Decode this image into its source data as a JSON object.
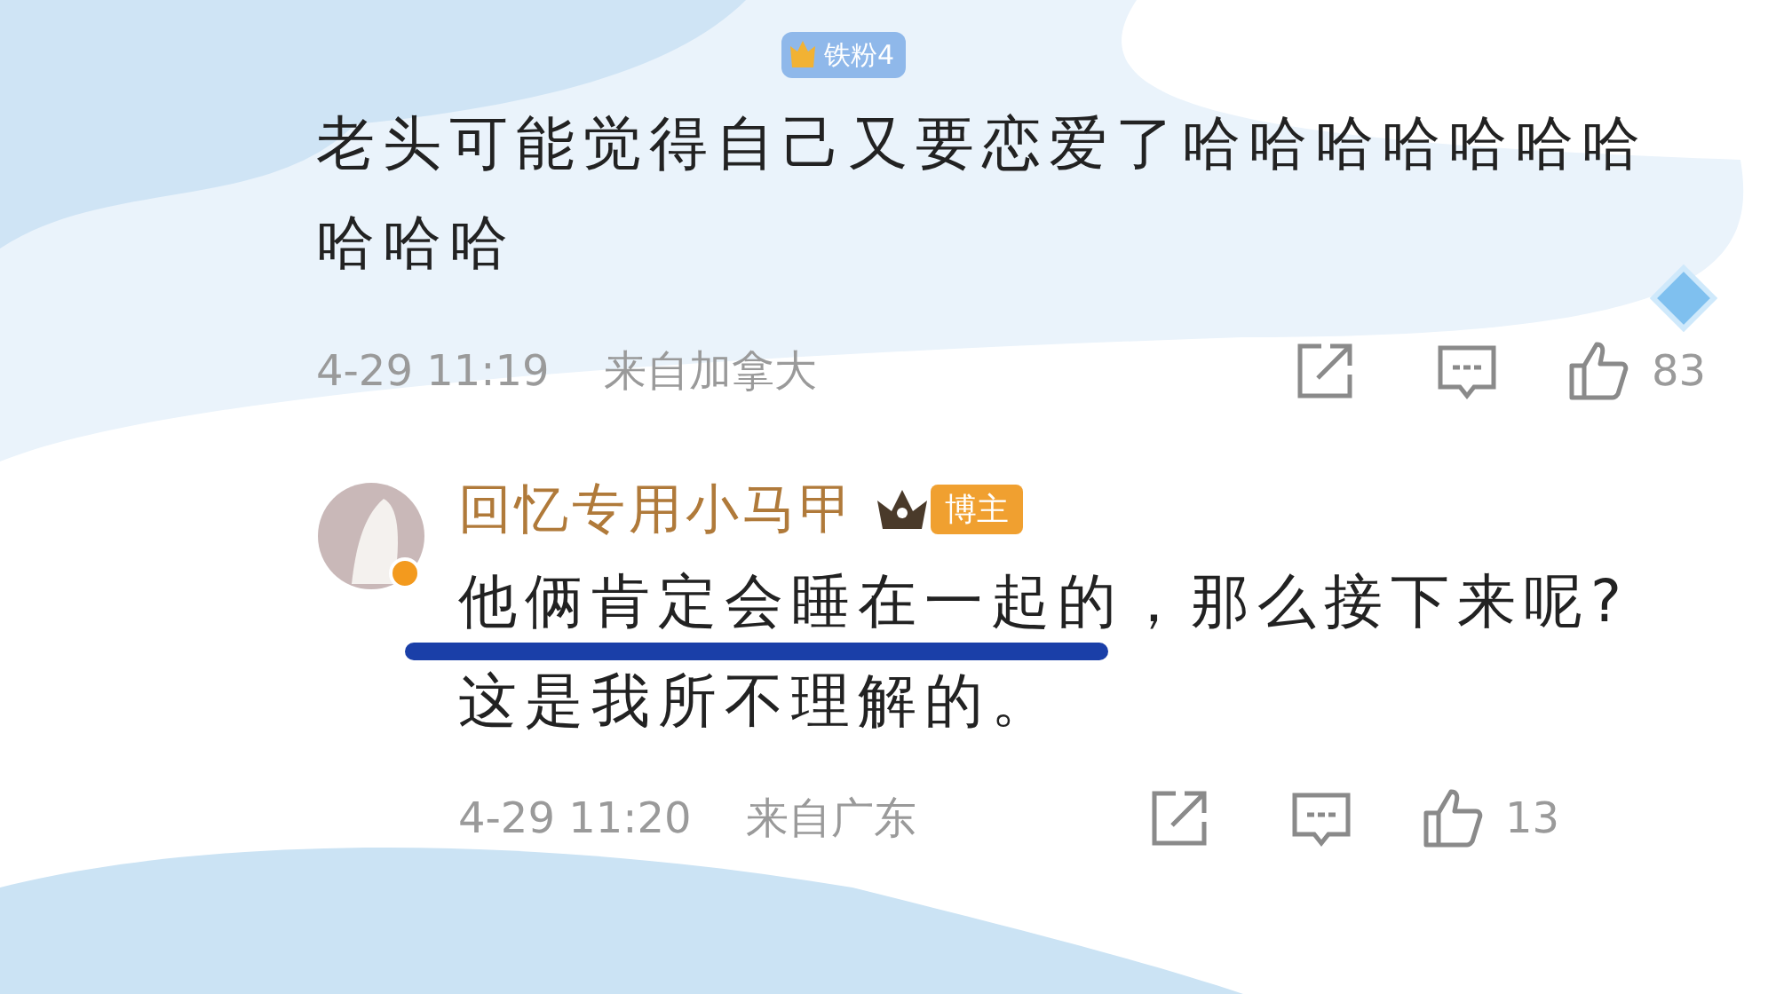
{
  "comments": [
    {
      "badge": "铁粉4",
      "text": "老头可能觉得自己又要恋爱了哈哈哈哈哈哈哈哈哈哈",
      "time": "4-29 11:19",
      "location": "来自加拿大",
      "likes": "83"
    },
    {
      "author": "回忆专用小马甲",
      "badge": "博主",
      "lines": [
        "他俩肯定会睡在一起的，那么接下来呢?",
        "这是我所不理解的。"
      ],
      "time": "4-29 11:20",
      "location": "来自广东",
      "likes": "13"
    }
  ]
}
